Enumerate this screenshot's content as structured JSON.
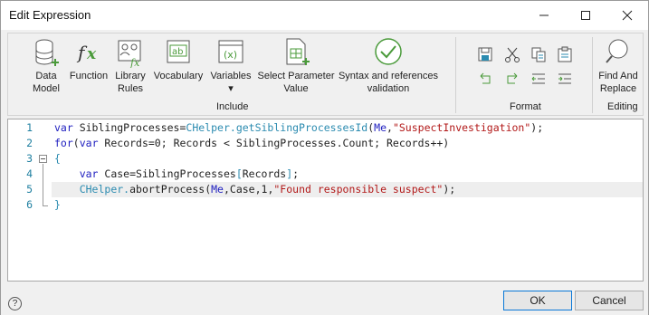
{
  "window": {
    "title": "Edit Expression"
  },
  "toolbar": {
    "include": {
      "label": "Include",
      "tools": [
        {
          "id": "data-model",
          "label": "Data\nModel",
          "icon": "database-icon"
        },
        {
          "id": "function",
          "label": "Function",
          "icon": "fx-icon"
        },
        {
          "id": "library-rules",
          "label": "Library\nRules",
          "icon": "library-rules-icon"
        },
        {
          "id": "vocabulary",
          "label": "Vocabulary",
          "icon": "ab-icon"
        },
        {
          "id": "variables",
          "label": "Variables\n▾",
          "icon": "variables-icon"
        },
        {
          "id": "select-parameter",
          "label": "Select Parameter\nValue",
          "icon": "parameter-icon"
        },
        {
          "id": "syntax-validation",
          "label": "Syntax and references\nvalidation",
          "icon": "check-icon"
        }
      ]
    },
    "format": {
      "label": "Format"
    },
    "editing": {
      "label": "Editing",
      "find_replace": "Find And\nReplace"
    }
  },
  "editor": {
    "line_numbers": [
      "1",
      "2",
      "3",
      "4",
      "5",
      "6"
    ],
    "lines": [
      [
        [
          "kw",
          "var "
        ],
        [
          "tx",
          "SiblingProcesses="
        ],
        [
          "cl",
          "CHelper"
        ],
        [
          "op",
          "."
        ],
        [
          "cl",
          "getSiblingProcessesId"
        ],
        [
          "tx",
          "("
        ],
        [
          "kw",
          "Me"
        ],
        [
          "tx",
          ","
        ],
        [
          "st",
          "\"SuspectInvestigation\""
        ],
        [
          "tx",
          ");"
        ]
      ],
      [
        [
          "kw",
          "for"
        ],
        [
          "tx",
          "("
        ],
        [
          "kw",
          "var "
        ],
        [
          "tx",
          "Records=0; Records < SiblingProcesses.Count; Records++)"
        ]
      ],
      [
        [
          "op",
          "{"
        ]
      ],
      [
        [
          "tx",
          "    "
        ],
        [
          "kw",
          "var "
        ],
        [
          "tx",
          "Case=SiblingProcesses"
        ],
        [
          "op",
          "["
        ],
        [
          "tx",
          "Records"
        ],
        [
          "op",
          "]"
        ],
        [
          "tx",
          ";"
        ]
      ],
      [
        [
          "tx",
          "    "
        ],
        [
          "cl",
          "CHelper"
        ],
        [
          "op",
          "."
        ],
        [
          "tx",
          "abortProcess("
        ],
        [
          "kw",
          "Me"
        ],
        [
          "tx",
          ",Case,1,"
        ],
        [
          "st",
          "\"Found responsible suspect\""
        ],
        [
          "tx",
          ");"
        ]
      ],
      [
        [
          "op",
          "}"
        ]
      ]
    ]
  },
  "footer": {
    "ok_label": "OK",
    "cancel_label": "Cancel",
    "help_label": "?"
  },
  "colors": {
    "keyword": "#2020c0",
    "string": "#b21818",
    "class": "#2b8bb0",
    "accent": "#0a78d7"
  }
}
